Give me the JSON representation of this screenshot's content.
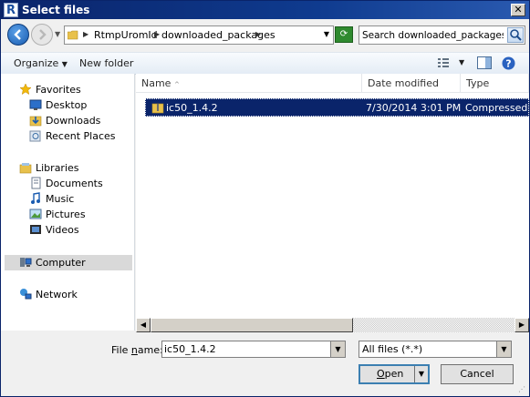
{
  "window": {
    "title": "Select files",
    "close_glyph": "✕",
    "app_icon_letter": "R"
  },
  "address": {
    "segments": [
      "RtmpUromId",
      "downloaded_packages"
    ]
  },
  "search": {
    "placeholder": "Search downloaded_packages"
  },
  "toolbar": {
    "organize_label": "Organize",
    "new_folder_label": "New folder"
  },
  "nav": {
    "favorites": {
      "label": "Favorites",
      "items": [
        "Desktop",
        "Downloads",
        "Recent Places"
      ]
    },
    "libraries": {
      "label": "Libraries",
      "items": [
        "Documents",
        "Music",
        "Pictures",
        "Videos"
      ]
    },
    "computer": "Computer",
    "network": "Network"
  },
  "columns": [
    "Name",
    "Date modified",
    "Type"
  ],
  "files": [
    {
      "name": "ic50_1.4.2",
      "date": "7/30/2014 3:01 PM",
      "type": "Compressed (zip"
    }
  ],
  "footer": {
    "filename_label_pre": "File ",
    "filename_label_key": "n",
    "filename_label_post": "ame:",
    "filename_value": "ic50_1.4.2",
    "filter_value": "All files (*.*)",
    "open_label_key": "O",
    "open_label_rest": "pen",
    "cancel_label": "Cancel"
  },
  "colors": {
    "selection": "#0a246a",
    "titlebar": "#0a246a"
  }
}
